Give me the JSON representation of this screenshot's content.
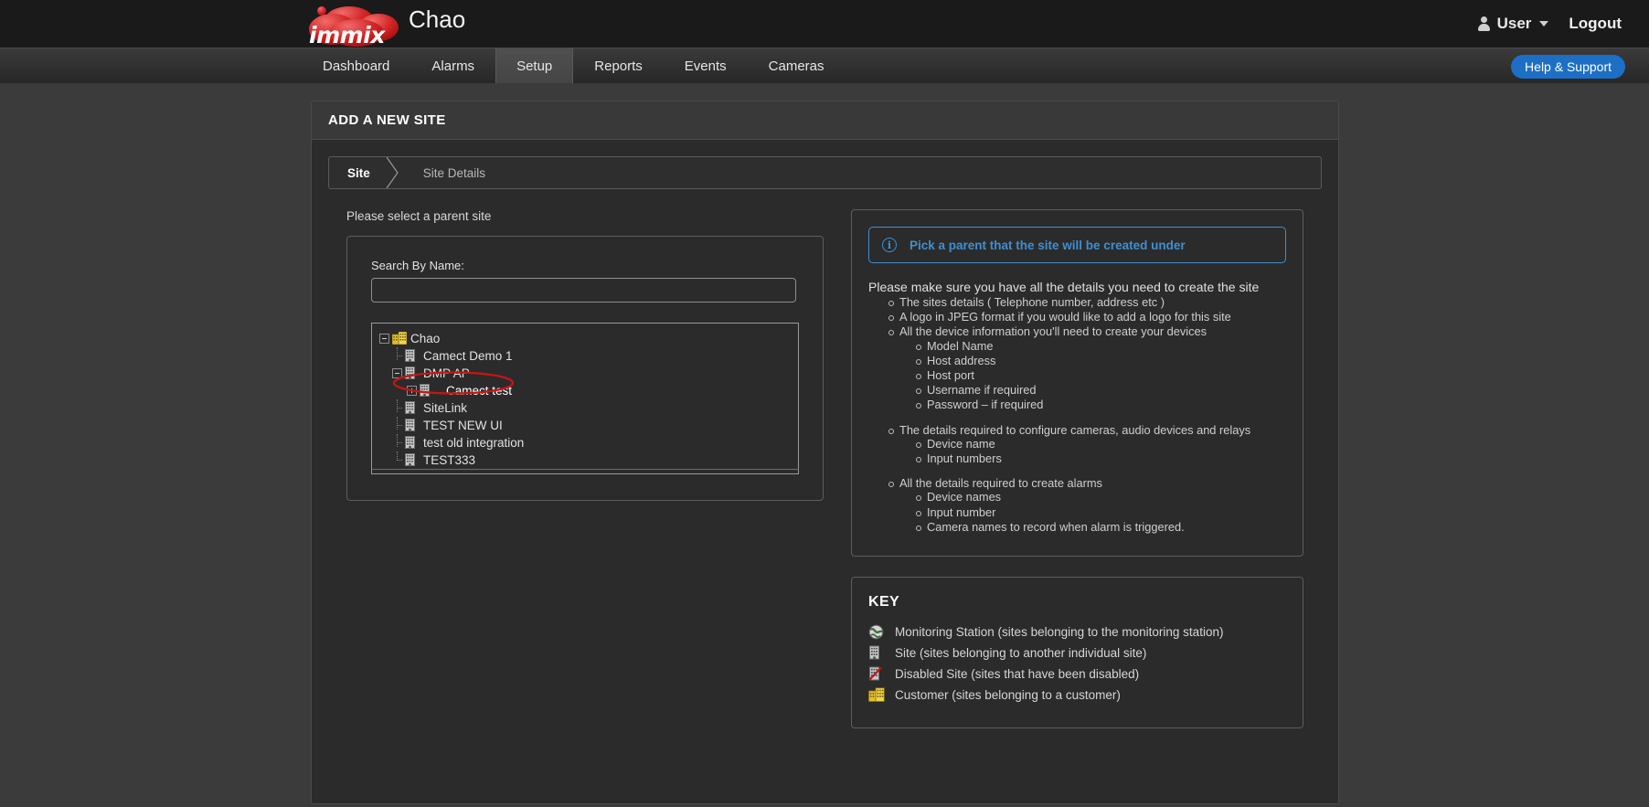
{
  "header": {
    "logo_text": "immix",
    "brand_title": "Chao",
    "user_label": "User",
    "logout_label": "Logout",
    "help_label": "Help & Support",
    "accent_blue": "#1c6fc4"
  },
  "nav": {
    "items": [
      {
        "label": "Dashboard",
        "active": false
      },
      {
        "label": "Alarms",
        "active": false
      },
      {
        "label": "Setup",
        "active": true
      },
      {
        "label": "Reports",
        "active": false
      },
      {
        "label": "Events",
        "active": false
      },
      {
        "label": "Cameras",
        "active": false
      }
    ]
  },
  "panel": {
    "title": "ADD A NEW SITE",
    "wizard": {
      "steps": [
        {
          "label": "Site",
          "current": true
        },
        {
          "label": "Site Details",
          "current": false
        }
      ]
    },
    "instruction": "Please select a parent site"
  },
  "search": {
    "label": "Search By Name:",
    "value": "",
    "placeholder": ""
  },
  "tree": {
    "nodes": [
      {
        "label": "Chao",
        "depth": 0,
        "toggle": "minus",
        "icon": "customer-icon",
        "highlighted": false
      },
      {
        "label": "Camect Demo 1",
        "depth": 1,
        "toggle": "none",
        "icon": "site-icon",
        "highlighted": false
      },
      {
        "label": "DMP AP",
        "depth": 1,
        "toggle": "minus",
        "icon": "site-icon",
        "highlighted": false
      },
      {
        "label": "Camect test",
        "depth": 2,
        "toggle": "plus",
        "icon": "site-icon",
        "highlighted": true
      },
      {
        "label": "SiteLink",
        "depth": 1,
        "toggle": "none",
        "icon": "site-icon",
        "highlighted": false
      },
      {
        "label": "TEST NEW UI",
        "depth": 1,
        "toggle": "none",
        "icon": "site-icon",
        "highlighted": false
      },
      {
        "label": "test old integration",
        "depth": 1,
        "toggle": "none",
        "icon": "site-icon",
        "highlighted": false
      },
      {
        "label": "TEST333",
        "depth": 1,
        "toggle": "none",
        "icon": "site-icon",
        "highlighted": false
      }
    ],
    "annotation_color": "#c81414"
  },
  "info": {
    "callout": "Pick a parent that the site will be created under",
    "callout_color": "#3f8fd0",
    "intro": "Please make sure you have all the details you need to create the site",
    "bullets": [
      {
        "text": "The sites details ( Telephone number, address etc )",
        "children": []
      },
      {
        "text": "A logo in JPEG format if you would like to add a logo for this site",
        "children": []
      },
      {
        "text": "All the device information you'll need to create your devices",
        "children": [
          "Model Name",
          "Host address",
          "Host port",
          "Username   if required",
          "Password – if required"
        ]
      },
      {
        "text": "The details required to configure cameras, audio devices and relays",
        "children": [
          "Device name",
          "Input numbers"
        ]
      },
      {
        "text": "All the details required to create alarms",
        "children": [
          "Device names",
          "Input number",
          "Camera names to record when alarm is triggered."
        ]
      }
    ]
  },
  "key": {
    "title": "KEY",
    "rows": [
      {
        "icon": "globe-icon",
        "label": "Monitoring Station (sites belonging to the monitoring station)"
      },
      {
        "icon": "site-icon",
        "label": "Site (sites belonging to another individual site)"
      },
      {
        "icon": "disabled-site-icon",
        "label": "Disabled Site (sites that have been disabled)"
      },
      {
        "icon": "customer-icon",
        "label": "Customer (sites belonging to a customer)"
      }
    ]
  }
}
